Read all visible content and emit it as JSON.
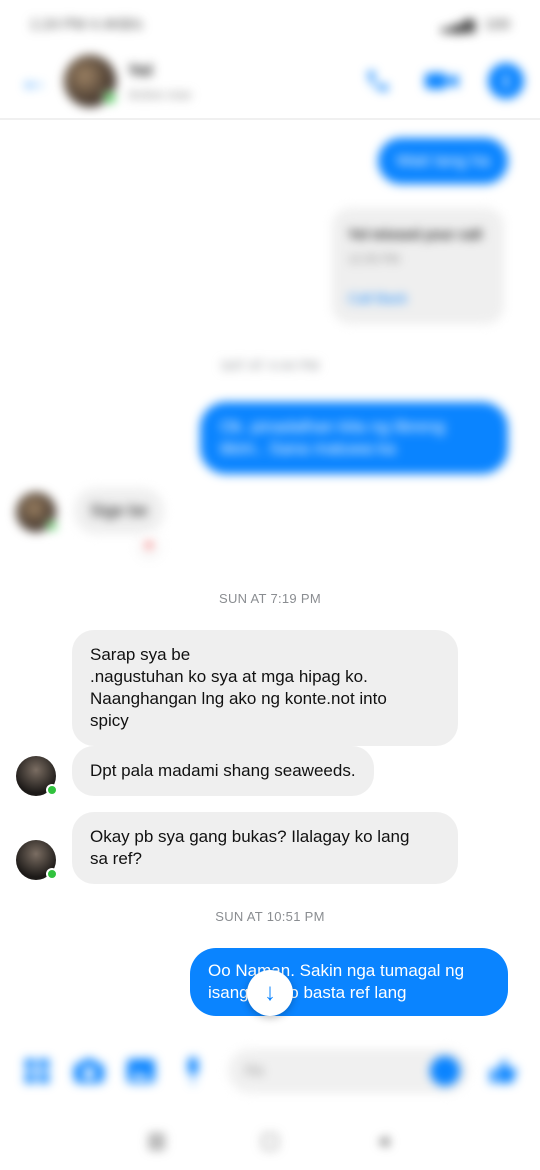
{
  "status_bar": {
    "time": "1:24 PM 4.4KB/s",
    "battery": "100"
  },
  "header": {
    "name": "Yel",
    "status": "Active now",
    "icons": {
      "back": "back-arrow-icon",
      "call": "phone-icon",
      "video": "video-camera-icon",
      "info": "info-icon"
    },
    "info_glyph": "i"
  },
  "messages": {
    "top_out": "Wait lang ha",
    "missed_call": {
      "title": "Yel missed your call",
      "sub": "12:35 PM",
      "action": "Call Back"
    },
    "ts0": "SAT AT 4:44 PM",
    "out_long": "Ok. pinadalhan kita ng libreng tikim.. Sana matuwa ka",
    "in_short": "Sige be",
    "reaction": "♥",
    "ts1": "SUN AT 7:19 PM",
    "in_1": [
      "Sarap sya be",
      ".nagustuhan ko sya at mga hipag ko.",
      "Naanghangan lng ako ng konte.not into",
      "spicy"
    ],
    "in_2": "Dpt pala madami shang seaweeds.",
    "in_3": [
      "Okay pb sya gang bukas? Ilalagay ko lang",
      "sa ref?"
    ],
    "ts2": "SUN AT 10:51 PM",
    "out_last": [
      "Oo Naman. Sakin nga tumagal ng",
      "isang linggo basta ref lang"
    ]
  },
  "scroll_down_glyph": "↓",
  "composer": {
    "placeholder": "Aa",
    "icons": {
      "menu": "grid-menu-icon",
      "camera": "camera-icon",
      "gallery": "gallery-icon",
      "mic": "microphone-icon",
      "emoji": "emoji-icon",
      "like": "thumbs-up-icon"
    }
  },
  "nav": {
    "recent": "▥",
    "home": "▢",
    "back": "◂"
  },
  "colors": {
    "accent": "#0a84ff",
    "incoming": "#efefef",
    "online": "#31c23e"
  }
}
